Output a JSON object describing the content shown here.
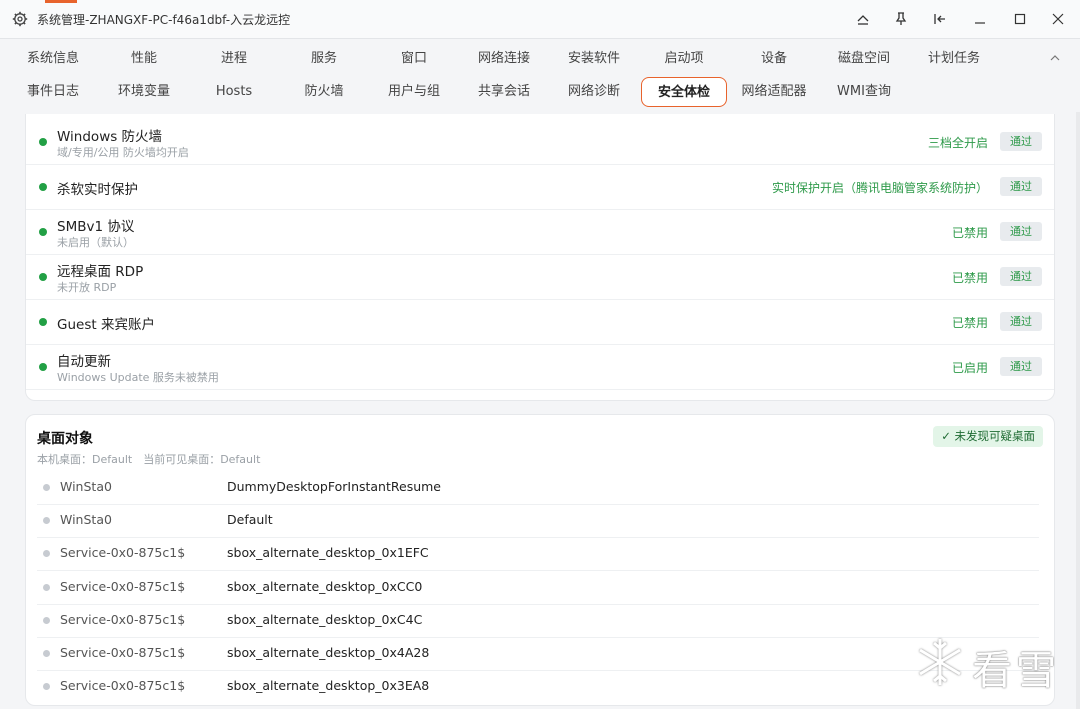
{
  "window": {
    "title": "系统管理-ZHANGXF-PC-f46a1dbf-入云龙远控"
  },
  "tabs_row1": [
    "系统信息",
    "性能",
    "进程",
    "服务",
    "窗口",
    "网络连接",
    "安装软件",
    "启动项",
    "设备",
    "磁盘空间",
    "计划任务"
  ],
  "tabs_row2": [
    "事件日志",
    "环境变量",
    "Hosts",
    "防火墙",
    "用户与组",
    "共享会话",
    "网络诊断",
    "安全体检",
    "网络适配器",
    "WMI查询"
  ],
  "active_tab": "安全体检",
  "security_checks": [
    {
      "title": "Windows 防火墙",
      "sub": "域/专用/公用 防火墙均开启",
      "status": "三档全开启",
      "badge": "通过"
    },
    {
      "title": "杀软实时保护",
      "sub": "",
      "status": "实时保护开启（腾讯电脑管家系统防护）",
      "badge": "通过"
    },
    {
      "title": "SMBv1 协议",
      "sub": "未启用（默认）",
      "status": "已禁用",
      "badge": "通过"
    },
    {
      "title": "远程桌面 RDP",
      "sub": "未开放 RDP",
      "status": "已禁用",
      "badge": "通过"
    },
    {
      "title": "Guest 来宾账户",
      "sub": "",
      "status": "已禁用",
      "badge": "通过"
    },
    {
      "title": "自动更新",
      "sub": "Windows Update 服务未被禁用",
      "status": "已启用",
      "badge": "通过"
    }
  ],
  "desktop_section": {
    "title": "桌面对象",
    "meta": "本机桌面：Default　当前可见桌面：Default",
    "ok_badge": "✓ 未发现可疑桌面",
    "rows": [
      {
        "station": "WinSta0",
        "desktop": "DummyDesktopForInstantResume"
      },
      {
        "station": "WinSta0",
        "desktop": "Default"
      },
      {
        "station": "Service-0x0-875c1$",
        "desktop": "sbox_alternate_desktop_0x1EFC"
      },
      {
        "station": "Service-0x0-875c1$",
        "desktop": "sbox_alternate_desktop_0xCC0"
      },
      {
        "station": "Service-0x0-875c1$",
        "desktop": "sbox_alternate_desktop_0xC4C"
      },
      {
        "station": "Service-0x0-875c1$",
        "desktop": "sbox_alternate_desktop_0x4A28"
      },
      {
        "station": "Service-0x0-875c1$",
        "desktop": "sbox_alternate_desktop_0x3EA8"
      }
    ]
  },
  "watermark": "看雪",
  "colors": {
    "accent": "#e8632c",
    "pass_green": "#2e9a4a",
    "dot_green": "#22a045"
  }
}
